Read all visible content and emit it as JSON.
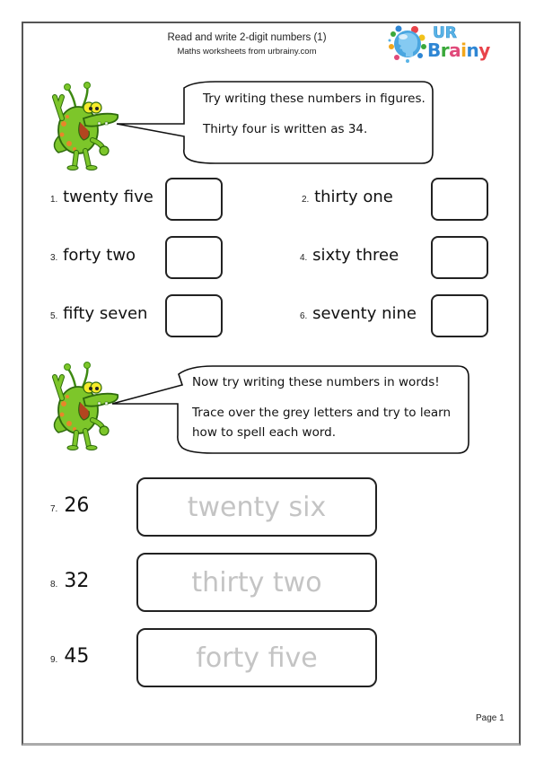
{
  "header": {
    "title": "Read and write 2-digit numbers (1)",
    "subtitle": "Maths worksheets from urbrainy.com"
  },
  "logo": {
    "icon": "head-globe-icon",
    "line1": "UR",
    "line2_letters": [
      {
        "char": "B",
        "color": "#2e86d4"
      },
      {
        "char": "r",
        "color": "#3aa83a"
      },
      {
        "char": "a",
        "color": "#e04a7a"
      },
      {
        "char": "i",
        "color": "#f2a71b"
      },
      {
        "char": "n",
        "color": "#2e86d4"
      },
      {
        "char": "y",
        "color": "#e8434a"
      }
    ]
  },
  "section1": {
    "mascot": "green-alien-mascot",
    "bubble_lines": [
      "Try writing these numbers in figures.",
      "Thirty four is written as 34."
    ],
    "questions": [
      {
        "num": "1.",
        "words": "twenty five",
        "answer": ""
      },
      {
        "num": "2.",
        "words": "thirty one",
        "answer": ""
      },
      {
        "num": "3.",
        "words": "forty two",
        "answer": ""
      },
      {
        "num": "4.",
        "words": "sixty three",
        "answer": ""
      },
      {
        "num": "5.",
        "words": "fifty seven",
        "answer": ""
      },
      {
        "num": "6.",
        "words": "seventy nine",
        "answer": ""
      }
    ]
  },
  "section2": {
    "mascot": "green-alien-mascot",
    "bubble_lines": [
      "Now try writing these numbers in words!",
      "Trace over the grey letters and try to learn",
      "how to spell each word."
    ],
    "questions": [
      {
        "num": "7.",
        "figure": "26",
        "trace": "twenty six"
      },
      {
        "num": "8.",
        "figure": "32",
        "trace": "thirty two"
      },
      {
        "num": "9.",
        "figure": "45",
        "trace": "forty five"
      }
    ]
  },
  "colors": {
    "alien_green": "#7dc62a",
    "alien_spots": "#e8862a",
    "trace_grey": "#c4c4c4"
  },
  "footer": {
    "page": "Page 1"
  }
}
